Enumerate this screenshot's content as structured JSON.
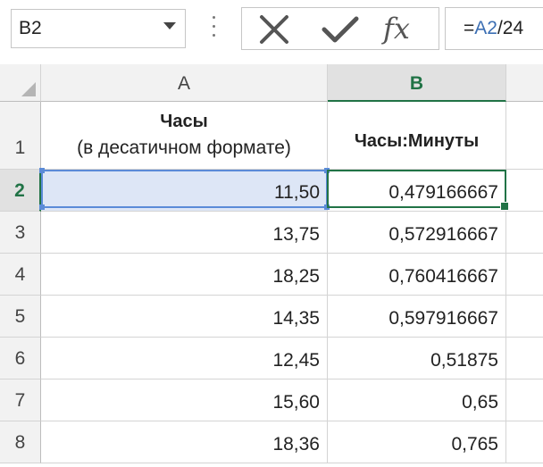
{
  "name_box": {
    "value": "B2"
  },
  "formula": {
    "prefix": "=",
    "ref": "A2",
    "rest": "/24"
  },
  "columns": [
    "A",
    "B"
  ],
  "header_row": {
    "row": "1",
    "a_line1": "Часы",
    "a_line2": "(в десатичном формате)",
    "b": "Часы:Минуты"
  },
  "rows": [
    {
      "row": "2",
      "a": "11,50",
      "b": "0,479166667"
    },
    {
      "row": "3",
      "a": "13,75",
      "b": "0,572916667"
    },
    {
      "row": "4",
      "a": "18,25",
      "b": "0,760416667"
    },
    {
      "row": "5",
      "a": "14,35",
      "b": "0,597916667"
    },
    {
      "row": "6",
      "a": "12,45",
      "b": "0,51875"
    },
    {
      "row": "7",
      "a": "15,60",
      "b": "0,65"
    },
    {
      "row": "8",
      "a": "18,36",
      "b": "0,765"
    }
  ],
  "active_cell": "B2",
  "colors": {
    "accent": "#217346",
    "reference": "#3c6fb4",
    "selection_fill": "#dde6f6"
  }
}
